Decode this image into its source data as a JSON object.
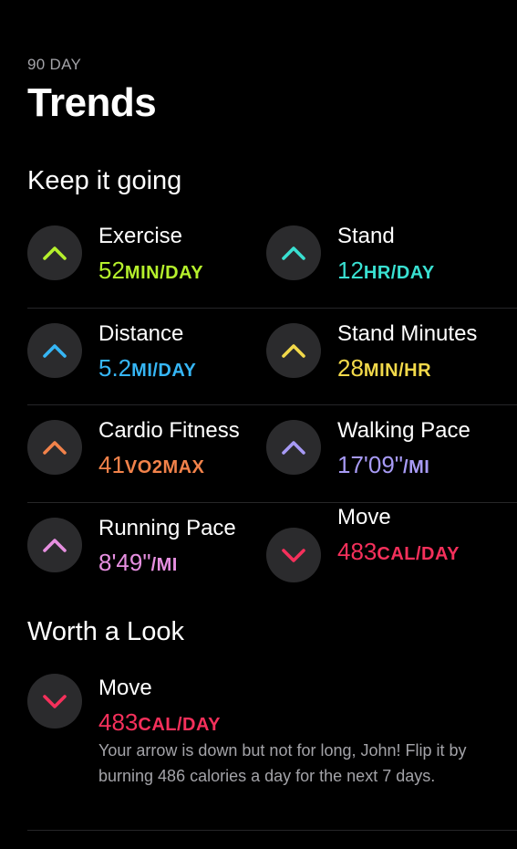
{
  "header": {
    "eyebrow": "90 DAY",
    "title": "Trends"
  },
  "keep_going": {
    "title": "Keep it going",
    "items": [
      {
        "label": "Exercise",
        "num": "52",
        "unit": "MIN/DAY",
        "color": "#b5f02c",
        "dir": "up",
        "icon": "chevron-up-icon"
      },
      {
        "label": "Stand",
        "num": "12",
        "unit": "HR/DAY",
        "color": "#39e0d1",
        "dir": "up",
        "icon": "chevron-up-icon"
      },
      {
        "label": "Distance",
        "num": "5.2",
        "unit": "MI/DAY",
        "color": "#36b6f5",
        "dir": "up",
        "icon": "chevron-up-icon"
      },
      {
        "label": "Stand Minutes",
        "num": "28",
        "unit": "MIN/HR",
        "color": "#f2d94a",
        "dir": "up",
        "icon": "chevron-up-icon"
      },
      {
        "label": "Cardio Fitness",
        "num": "41",
        "unit": "VO2MAX",
        "color": "#f2824a",
        "dir": "up",
        "icon": "chevron-up-icon"
      },
      {
        "label": "Walking Pace",
        "num": "17'09\"",
        "unit": "/MI",
        "color": "#a79af5",
        "dir": "up",
        "icon": "chevron-up-icon"
      },
      {
        "label": "Running Pace",
        "num": "8'49\"",
        "unit": "/MI",
        "color": "#e68fe0",
        "dir": "up",
        "icon": "chevron-up-icon"
      },
      {
        "label": "Move",
        "num": "483",
        "unit": "CAL/DAY",
        "color": "#f5305b",
        "dir": "down",
        "icon": "chevron-down-icon"
      }
    ]
  },
  "worth_a_look": {
    "title": "Worth a Look",
    "item": {
      "label": "Move",
      "num": "483",
      "unit": "CAL/DAY",
      "color": "#f5305b",
      "dir": "down",
      "icon": "chevron-down-icon",
      "description": "Your arrow is down but not for long, John! Flip it by burning 486 calories a day for the next 7 days."
    }
  }
}
